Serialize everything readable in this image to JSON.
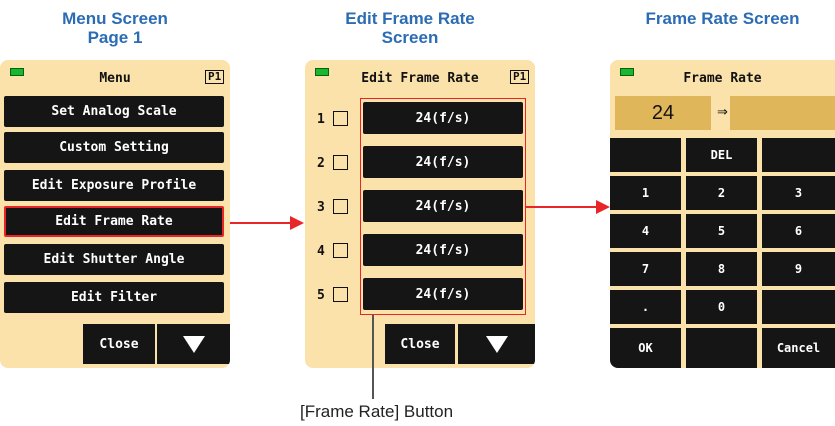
{
  "titles": {
    "menu_line1": "Menu Screen",
    "menu_line2": "Page 1",
    "edit_line1": "Edit Frame Rate",
    "edit_line2": "Screen",
    "rate": "Frame Rate Screen"
  },
  "menu": {
    "header": "Menu",
    "page": "P1",
    "items": [
      "Set Analog Scale",
      "Custom Setting",
      "Edit Exposure Profile",
      "Edit Frame Rate",
      "Edit Shutter Angle",
      "Edit Filter"
    ],
    "close": "Close"
  },
  "edit": {
    "header": "Edit Frame Rate",
    "page": "P1",
    "rows": [
      {
        "num": "1",
        "value": "24(f/s)"
      },
      {
        "num": "2",
        "value": "24(f/s)"
      },
      {
        "num": "3",
        "value": "24(f/s)"
      },
      {
        "num": "4",
        "value": "24(f/s)"
      },
      {
        "num": "5",
        "value": "24(f/s)"
      }
    ],
    "close": "Close"
  },
  "rate": {
    "header": "Frame Rate",
    "current": "24",
    "arrow": "⇒",
    "new_value": "",
    "keys": [
      "",
      "DEL",
      "",
      "1",
      "2",
      "3",
      "4",
      "5",
      "6",
      "7",
      "8",
      "9",
      ".",
      "0",
      "",
      "OK",
      "",
      "Cancel"
    ]
  },
  "annotation": "[Frame Rate] Button",
  "colors": {
    "title_blue": "#2b6cb5",
    "screen_bg": "#fbe2ab",
    "button_black": "#151515",
    "highlight_red": "#e8262a",
    "value_box": "#e0b65b",
    "battery_green": "#18b82e"
  },
  "icons": [
    "battery-icon",
    "down-triangle-icon",
    "right-arrow-icon"
  ]
}
